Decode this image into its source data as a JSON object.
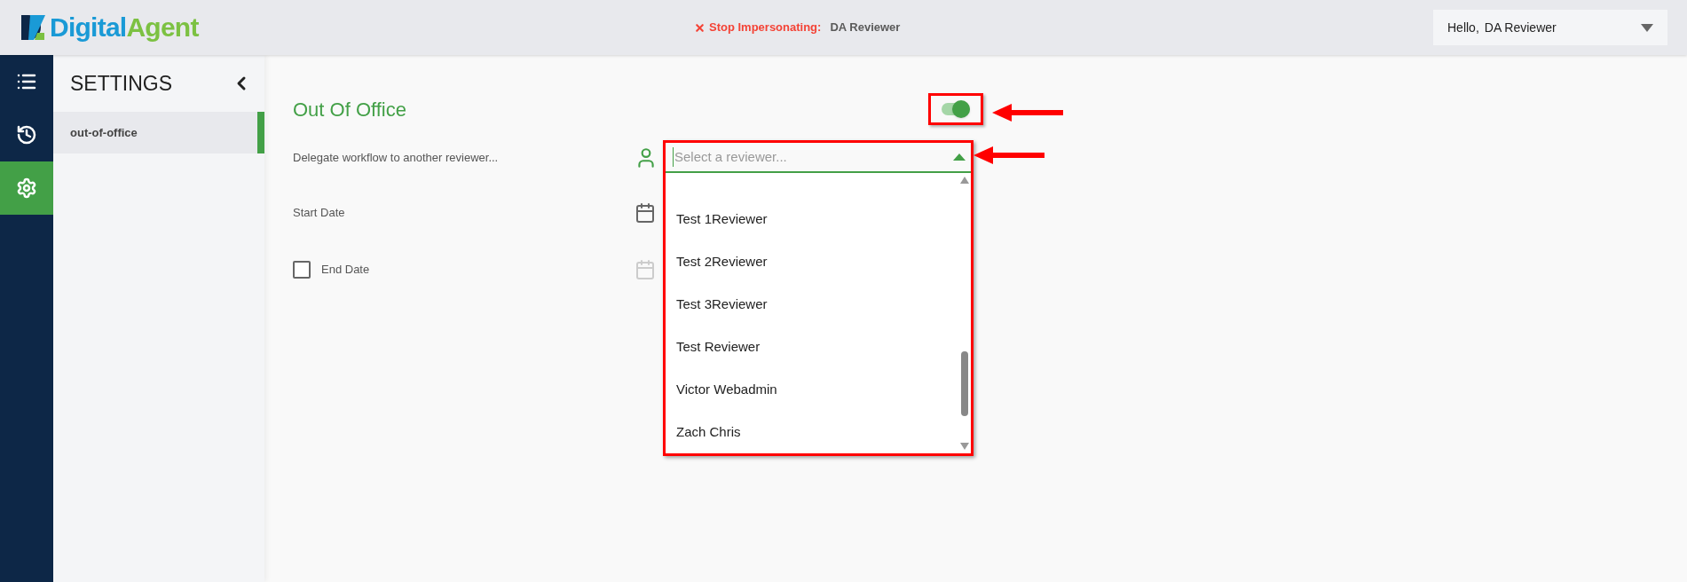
{
  "header": {
    "logo": {
      "primary": "Digital",
      "secondary": "Agent"
    },
    "impersonation": {
      "action": "Stop Impersonating:",
      "user": "DA Reviewer"
    },
    "user_menu": {
      "greeting": "Hello,",
      "name": "DA Reviewer"
    }
  },
  "nav_rail": [
    {
      "kind": "list",
      "selected": false
    },
    {
      "kind": "history",
      "selected": false
    },
    {
      "kind": "settings",
      "selected": true
    }
  ],
  "sidebar": {
    "title": "SETTINGS",
    "items": [
      {
        "label": "out-of-office",
        "selected": true
      }
    ]
  },
  "out_of_office": {
    "title": "Out Of Office",
    "toggle": {
      "on": true,
      "highlighted": true
    },
    "delegate": {
      "label": "Delegate workflow to another reviewer...",
      "placeholder": "Select a reviewer...",
      "expanded": true,
      "highlighted": true,
      "options": [
        "Test 1Reviewer",
        "Test 2Reviewer",
        "Test 3Reviewer",
        "Test Reviewer",
        "Victor Webadmin",
        "Zach Chris"
      ]
    },
    "start_date": {
      "label": "Start Date"
    },
    "end_date": {
      "label": "End Date",
      "checked": false,
      "disabled": true
    }
  }
}
